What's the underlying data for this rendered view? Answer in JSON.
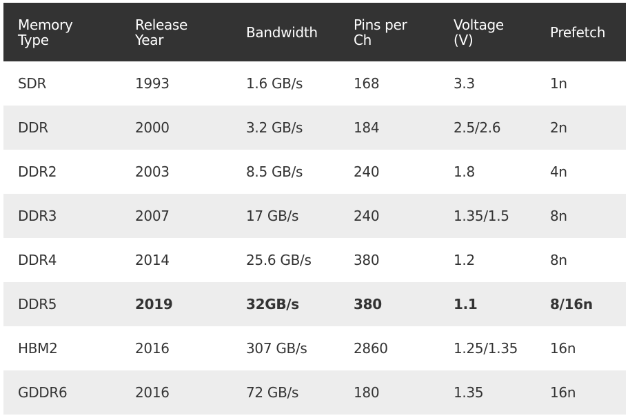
{
  "table": {
    "headers": [
      "Memory Type",
      "Release Year",
      "Bandwidth",
      "Pins per Ch",
      "Voltage (V)",
      "Prefetch"
    ],
    "header_lines": [
      [
        "Memory",
        "Type"
      ],
      [
        "Release",
        "Year"
      ],
      [
        "Bandwidth"
      ],
      [
        "Pins per",
        "Ch"
      ],
      [
        "Voltage",
        "(V)"
      ],
      [
        "Prefetch"
      ]
    ],
    "rows": [
      [
        "SDR",
        "1993",
        "1.6 GB/s",
        "168",
        "3.3",
        "1n"
      ],
      [
        "DDR",
        "2000",
        "3.2 GB/s",
        "184",
        "2.5/2.6",
        "2n"
      ],
      [
        "DDR2",
        "2003",
        "8.5 GB/s",
        "240",
        "1.8",
        "4n"
      ],
      [
        "DDR3",
        "2007",
        "17 GB/s",
        "240",
        "1.35/1.5",
        "8n"
      ],
      [
        "DDR4",
        "2014",
        "25.6 GB/s",
        "380",
        "1.2",
        "8n"
      ],
      [
        "DDR5",
        "2019",
        "32GB/s",
        "380",
        "1.1",
        "8/16n"
      ],
      [
        "HBM2",
        "2016",
        "307 GB/s",
        "2860",
        "1.25/1.35",
        "16n"
      ],
      [
        "GDDR6",
        "2016",
        "72 GB/s",
        "180",
        "1.35",
        "16n"
      ]
    ],
    "highlighted_row": "DDR5",
    "colors": {
      "header_bg": "#333333",
      "header_text": "#ffffff",
      "stripe": "#ededed",
      "text": "#333333"
    }
  }
}
